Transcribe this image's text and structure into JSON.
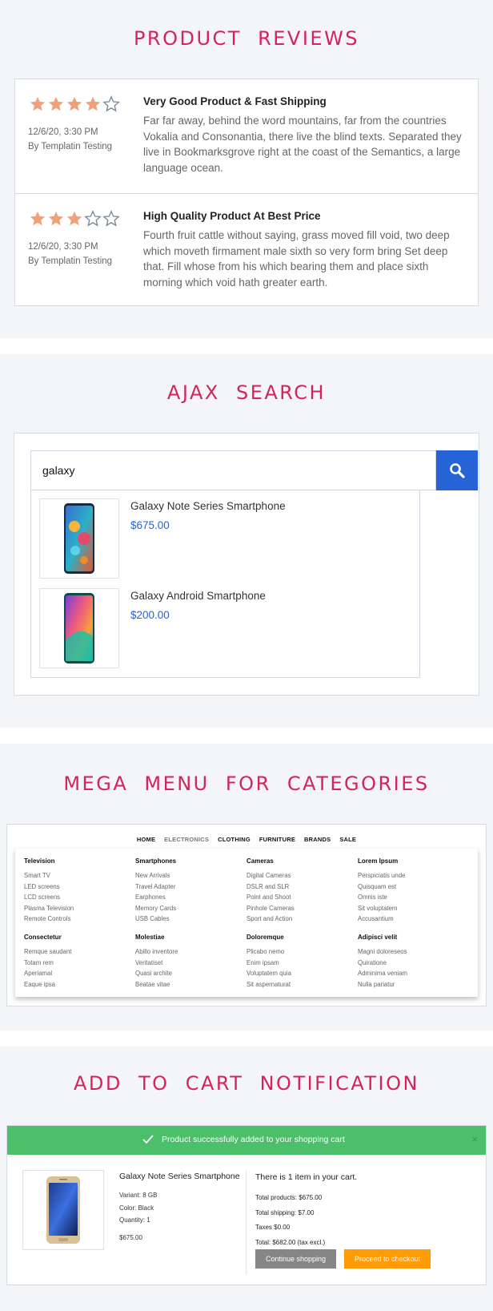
{
  "reviews_section": {
    "title": "PRODUCT REVIEWS",
    "colors": {
      "star_fill": "#f0a07a",
      "star_empty": "#7b8a99"
    },
    "reviews": [
      {
        "rating": 4,
        "max_rating": 5,
        "date": "12/6/20, 3:30 PM",
        "author": "By Templatin Testing",
        "title": "Very Good Product & Fast Shipping",
        "text": "Far far away, behind the word mountains, far from the countries Vokalia and Consonantia, there live the blind texts. Separated they live in Bookmarksgrove right at the coast of the Semantics, a large language ocean."
      },
      {
        "rating": 3,
        "max_rating": 5,
        "date": "12/6/20, 3:30 PM",
        "author": "By Templatin Testing",
        "title": "High Quality Product At Best Price",
        "text": "Fourth fruit cattle without saying, grass moved fill void, two deep which moveth firmament male sixth so very form bring Set deep that. Fill whose from his which bearing them and place sixth morning which void hath greater earth."
      }
    ]
  },
  "search_section": {
    "title": "AJAX SEARCH",
    "query": "galaxy",
    "button_icon": "search-icon",
    "results": [
      {
        "name": "Galaxy Note Series Smartphone",
        "price": "$675.00"
      },
      {
        "name": "Galaxy Android Smartphone",
        "price": "$200.00"
      }
    ]
  },
  "mega_section": {
    "title": "MEGA MENU FOR CATEGORIES",
    "nav": [
      "HOME",
      "ELECTRONICS",
      "CLOTHING",
      "FURNITURE",
      "BRANDS",
      "SALE"
    ],
    "columns": [
      {
        "heading": "Television",
        "items": [
          "Smart TV",
          "LED screens",
          "LCD screens",
          "Plasma Television",
          "Remote Controls"
        ]
      },
      {
        "heading": "Smartphones",
        "items": [
          "New Arrivals",
          "Travel Adapter",
          "Earphones",
          "Memory Cards",
          "USB Cables"
        ]
      },
      {
        "heading": "Cameras",
        "items": [
          "Digital Cameras",
          "DSLR and SLR",
          "Point and Shoot",
          "Pinhole Cameras",
          "Sport and Action"
        ]
      },
      {
        "heading": "Lorem Ipsum",
        "items": [
          "Perspiciatis unde",
          "Quisquam est",
          "Omnis iste",
          "Sit voluptatem",
          "Accusantium"
        ]
      },
      {
        "heading": "Consectetur",
        "items": [
          "Remque saudant",
          "Totam rem",
          "Aperiamal",
          "Eaque ipsa"
        ]
      },
      {
        "heading": "Molestiae",
        "items": [
          "Abillo inventore",
          "Veritatiset",
          "Quasi archite",
          "Beatae vitae"
        ]
      },
      {
        "heading": "Doloremque",
        "items": [
          "Plicabo nemo",
          "Enim ipsam",
          "Voluptatem quia",
          "Sit aspernaturat"
        ]
      },
      {
        "heading": "Adipisci velit",
        "items": [
          "Magni doloreseos",
          "Quiratione",
          "Adminima veniam",
          "Nulla pariatur"
        ]
      }
    ]
  },
  "cart_section": {
    "title": "ADD TO CART NOTIFICATION",
    "banner": "Product successfully added to your shopping cart",
    "close": "×",
    "product": {
      "name": "Galaxy Note Series Smartphone",
      "variant": "Variant: 8 GB",
      "color": "Color: Black",
      "quantity": "Quantity: 1",
      "price": "$675.00"
    },
    "summary": {
      "heading": "There is 1 item in your cart.",
      "total_products": "Total products: $675.00",
      "total_shipping": "Total shipping: $7.00",
      "taxes": "Taxes $0.00",
      "total": "Total: $682.00 (tax excl.)"
    },
    "buttons": {
      "continue": "Continue shopping",
      "checkout": "Proceed to checkout"
    }
  }
}
